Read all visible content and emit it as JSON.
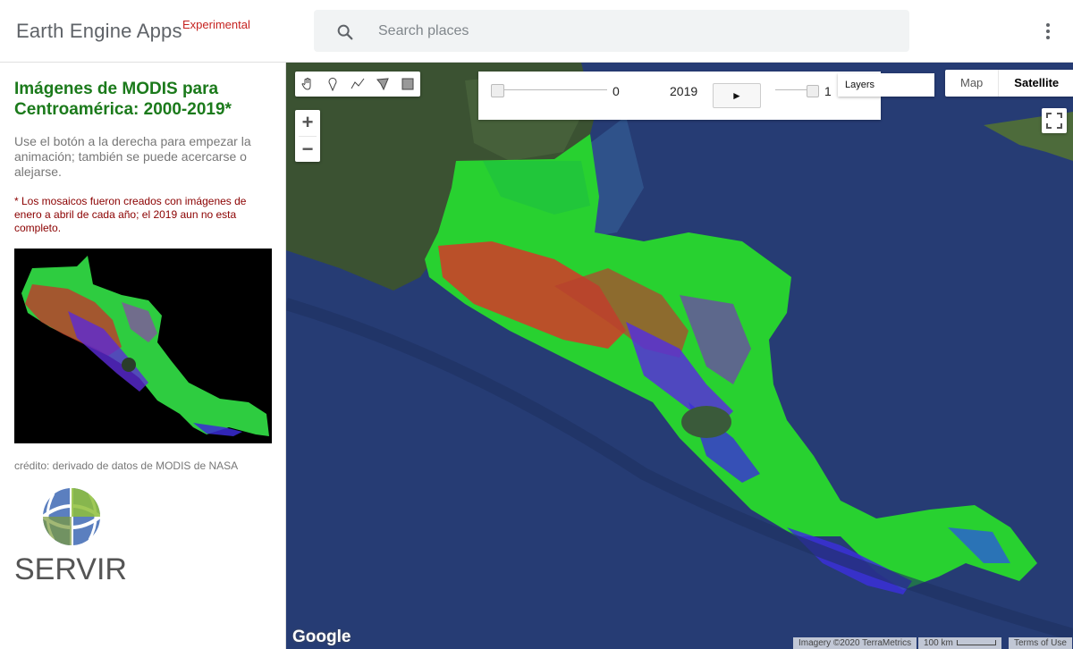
{
  "header": {
    "app_title": "Earth Engine Apps",
    "badge": "Experimental",
    "search_placeholder": "Search places",
    "search_value": "",
    "icons": {
      "search": "search-icon",
      "menu": "more-vert-icon"
    }
  },
  "panel": {
    "title": "Imágenes de MODIS para Centroamérica: 2000-2019*",
    "instructions": "Use el botón a la derecha para empezar la animación; también se puede acercarse o alejarse.",
    "note": "* Los mosaicos fueron creados con imágenes de enero a abril de cada año; el 2019 aun no esta completo.",
    "credit": "crédito: derivado de datos de MODIS de NASA",
    "logo_text": "SERVIR"
  },
  "map": {
    "draw_tools": [
      "hand-icon",
      "marker-icon",
      "line-icon",
      "polygon-icon",
      "rectangle-icon"
    ],
    "zoom_in": "+",
    "zoom_out": "−",
    "animation": {
      "slider_value": "0",
      "slider_fraction": 0,
      "year": "2019",
      "play_label": "►",
      "opacity_value": "1",
      "opacity_fraction": 1
    },
    "layers_label": "Layers",
    "map_types": [
      "Map",
      "Satellite"
    ],
    "active_map_type": "Satellite",
    "google_label": "Google",
    "attribution": "Imagery ©2020 TerraMetrics",
    "scale_label": "100 km",
    "terms_label": "Terms of Use"
  },
  "colors": {
    "title_green": "#1b7a1b",
    "note_red": "#8b0000",
    "badge_red": "#c5221f",
    "ocean": "#253a70"
  }
}
